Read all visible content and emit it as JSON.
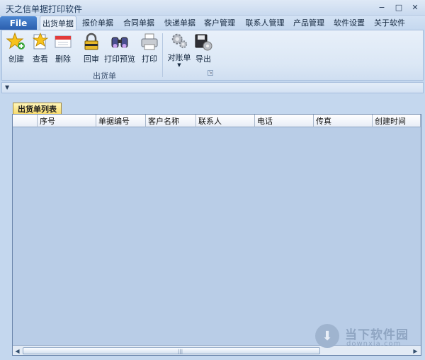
{
  "window": {
    "title": "天之信单据打印软件",
    "controls": [
      "−",
      "□",
      "✕"
    ]
  },
  "ribbon_tabs": {
    "file": "File",
    "tabs": [
      "出货单据",
      "报价单据",
      "合同单据",
      "快递单据",
      "客户管理",
      "联系人管理",
      "产品管理",
      "软件设置",
      "关于软件"
    ],
    "active_index": 0
  },
  "ribbon": {
    "group1": {
      "label": "出货单",
      "buttons": [
        {
          "label": "创建",
          "icon": "star-create-icon"
        },
        {
          "label": "查看",
          "icon": "document-view-icon"
        },
        {
          "label": "删除",
          "icon": "delete-icon"
        },
        {
          "label": "回审",
          "icon": "lock-icon"
        },
        {
          "label": "打印预览",
          "icon": "binoculars-icon"
        },
        {
          "label": "打印",
          "icon": "printer-icon"
        }
      ]
    },
    "group2": {
      "buttons": [
        {
          "label": "对账单",
          "icon": "gears-icon"
        },
        {
          "label": "导出",
          "icon": "export-disk-icon"
        }
      ]
    }
  },
  "document_tab": "出货单列表",
  "grid": {
    "columns": [
      "",
      "序号",
      "单据编号",
      "客户名称",
      "联系人",
      "电话",
      "传真",
      "创建时间"
    ]
  },
  "watermark": {
    "name": "当下软件园",
    "url": "downxia.com"
  },
  "colors": {
    "accent": "#2b5fae",
    "background": "#c4d7ee",
    "tab_highlight": "#f6d96b"
  }
}
